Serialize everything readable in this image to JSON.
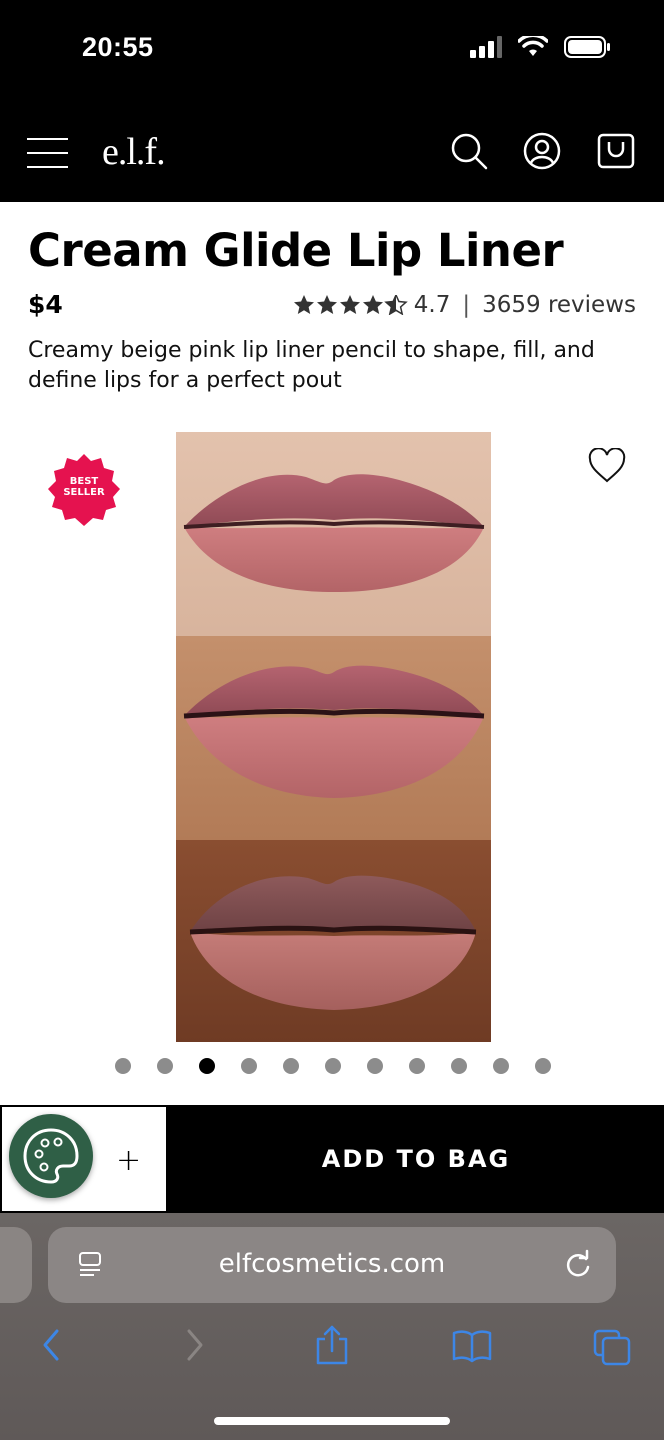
{
  "status_bar": {
    "time": "20:55"
  },
  "header": {
    "logo": "e.l.f."
  },
  "product": {
    "title": "Cream Glide Lip Liner",
    "price": "$4",
    "rating": "4.7",
    "separator": "|",
    "reviews": "3659 reviews",
    "description": "Creamy beige pink lip liner pencil to shape, fill, and define lips for a perfect pout",
    "badge": "BEST SELLER",
    "image_count": 11,
    "active_image": 3
  },
  "sticky_bar": {
    "qty_plus": "+",
    "add_to_bag": "ADD TO BAG"
  },
  "browser": {
    "url": "elfcosmetics.com"
  },
  "colors": {
    "accent_badge": "#e5124f",
    "palette_button": "#2f5f46",
    "link_blue": "#3d86e6"
  }
}
